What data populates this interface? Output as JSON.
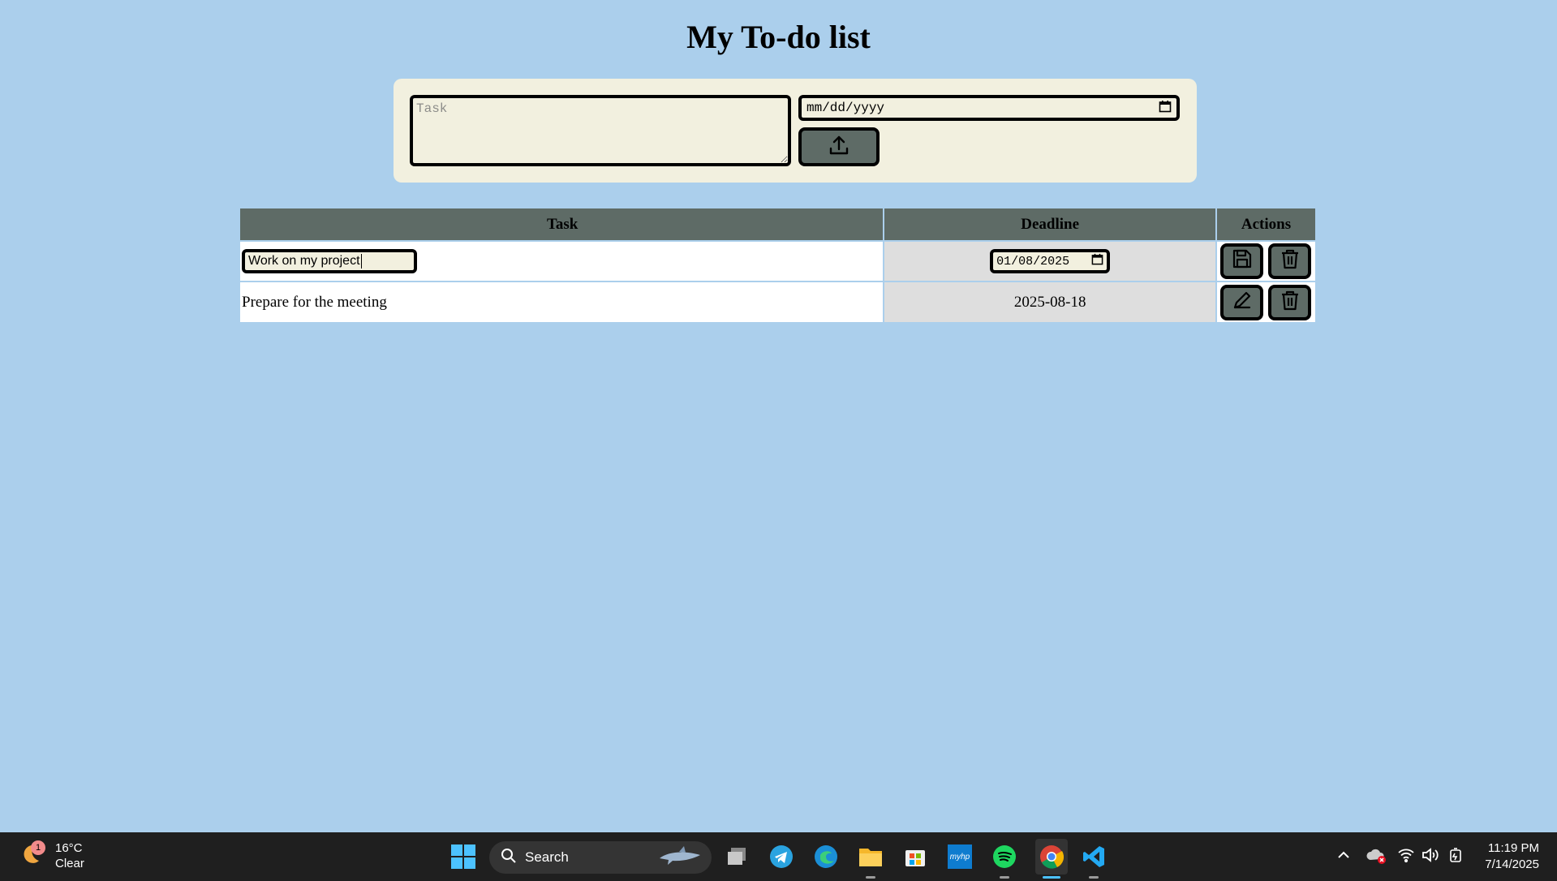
{
  "page": {
    "title": "My To-do list"
  },
  "form": {
    "task_placeholder": "Task",
    "date_placeholder": "mm/dd/yyyy",
    "upload_icon": "upload-icon"
  },
  "table": {
    "headers": {
      "task": "Task",
      "deadline": "Deadline",
      "actions": "Actions"
    },
    "rows": [
      {
        "task": "Work on my project",
        "deadline": "01/08/2025",
        "editing": true,
        "save_icon": "save-icon",
        "delete_icon": "trash-icon"
      },
      {
        "task": "Prepare for the meeting",
        "deadline": "2025-08-18",
        "editing": false,
        "edit_icon": "pencil-icon",
        "delete_icon": "trash-icon"
      }
    ]
  },
  "taskbar": {
    "weather": {
      "badge": "1",
      "temp": "16°C",
      "condition": "Clear"
    },
    "search_label": "Search",
    "apps": [
      "windows-start",
      "task-view",
      "telegram",
      "edge",
      "file-explorer",
      "microsoft-store",
      "myhp",
      "spotify",
      "chrome",
      "vscode"
    ],
    "myhp_label": "myhp",
    "clock": {
      "time": "11:19 PM",
      "date": "7/14/2025"
    }
  },
  "colors": {
    "background": "#abcfec",
    "panel": "#f2f0df",
    "header": "#5e6b66",
    "deadline_cell": "#dedede"
  }
}
